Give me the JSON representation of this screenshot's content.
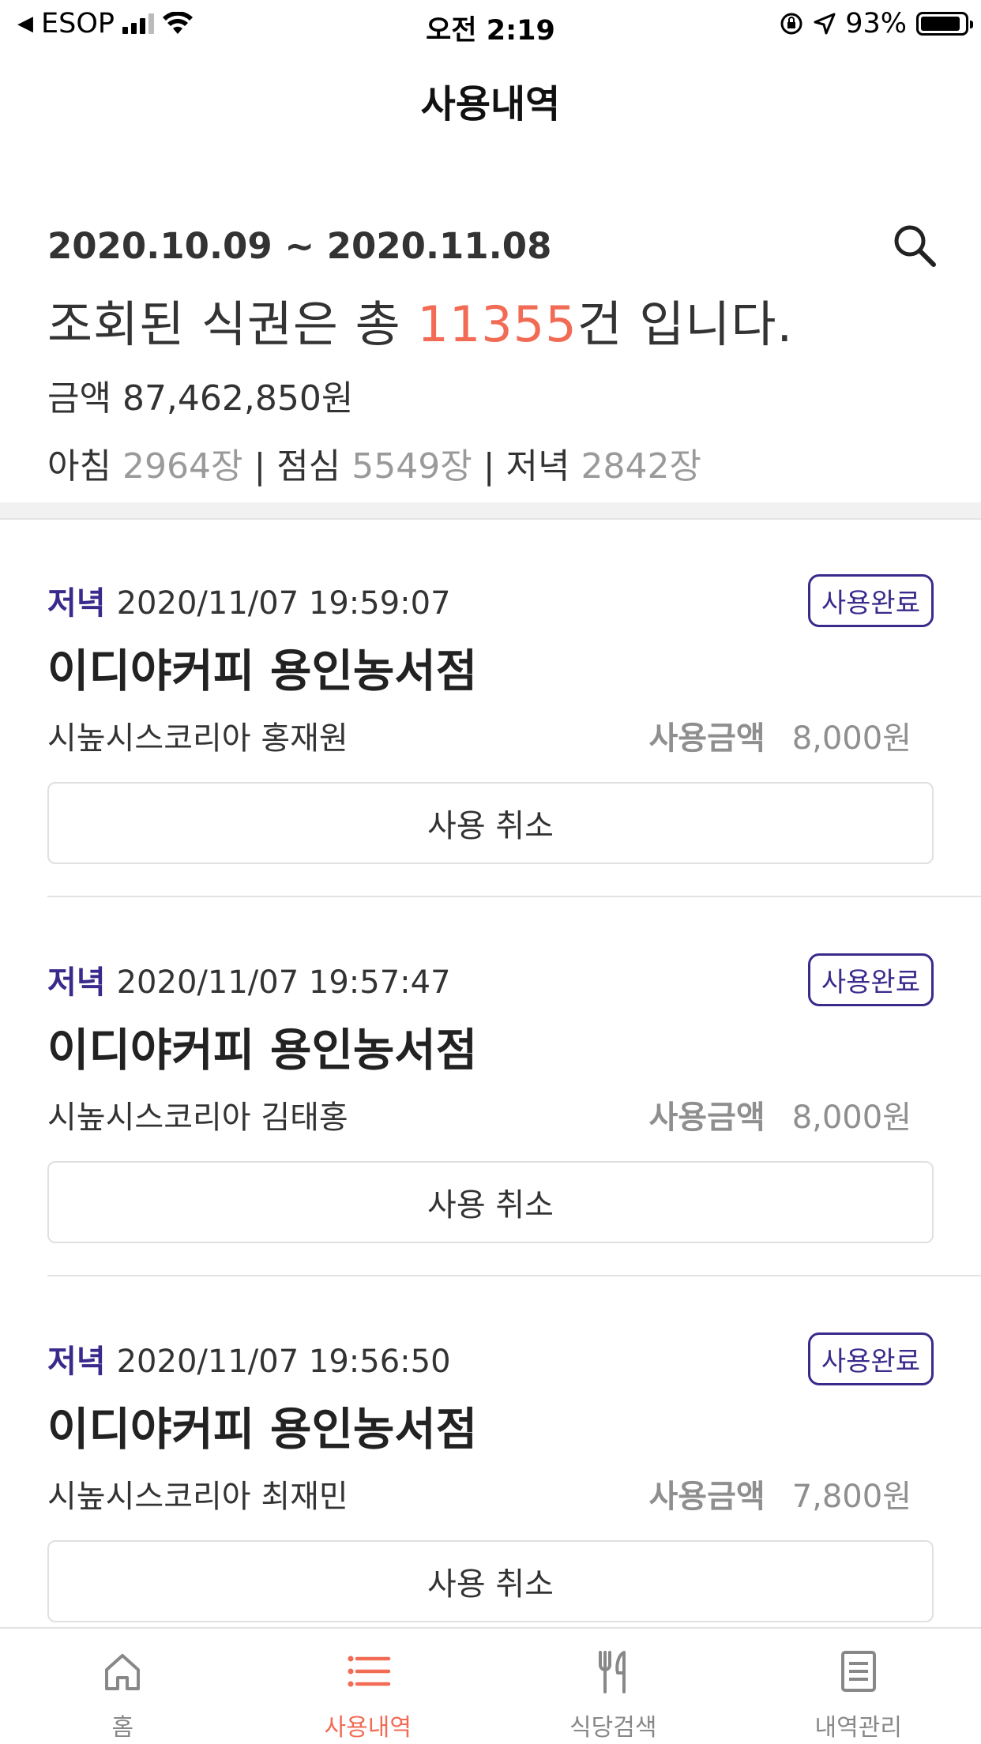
{
  "status_bar": {
    "back_app": "ESOP",
    "time": "오전 2:19",
    "battery": "93%"
  },
  "header": {
    "title": "사용내역"
  },
  "summary": {
    "date_range": "2020.10.09 ~ 2020.11.08",
    "count_prefix": "조회된 식권은 총 ",
    "count_value": "11355",
    "count_suffix": "건 입니다.",
    "amount": "금액 87,462,850원",
    "breakfast_label": "아침",
    "breakfast_count": "2964장",
    "lunch_label": "점심",
    "lunch_count": "5549장",
    "dinner_label": "저녁",
    "dinner_count": "2842장",
    "sep": "|"
  },
  "records": [
    {
      "meal": "저녁",
      "datetime": "2020/11/07 19:59:07",
      "badge": "사용완료",
      "store": "이디야커피 용인농서점",
      "user": "시높시스코리아 홍재원",
      "amount_label": "사용금액",
      "amount": "8,000원",
      "cancel": "사용 취소"
    },
    {
      "meal": "저녁",
      "datetime": "2020/11/07 19:57:47",
      "badge": "사용완료",
      "store": "이디야커피 용인농서점",
      "user": "시높시스코리아 김태홍",
      "amount_label": "사용금액",
      "amount": "8,000원",
      "cancel": "사용 취소"
    },
    {
      "meal": "저녁",
      "datetime": "2020/11/07 19:56:50",
      "badge": "사용완료",
      "store": "이디야커피 용인농서점",
      "user": "시높시스코리아 최재민",
      "amount_label": "사용금액",
      "amount": "7,800원",
      "cancel": "사용 취소"
    }
  ],
  "tabs": [
    {
      "label": "홈",
      "icon": "home-icon"
    },
    {
      "label": "사용내역",
      "icon": "list-icon",
      "active": true
    },
    {
      "label": "식당검색",
      "icon": "utensils-icon"
    },
    {
      "label": "내역관리",
      "icon": "document-icon"
    }
  ],
  "colors": {
    "accent": "#f26b55",
    "badge": "#3b2a8c"
  }
}
